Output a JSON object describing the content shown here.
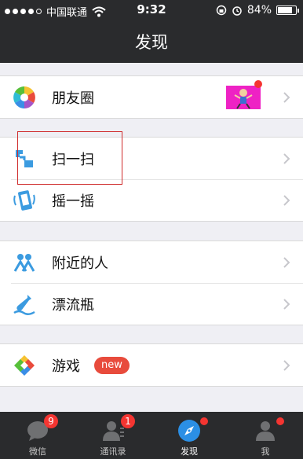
{
  "status_bar": {
    "carrier": "中国联通",
    "time": "9:32",
    "battery": "84%",
    "signal_bars": 4,
    "battery_level": 0.84
  },
  "header": {
    "title": "发现"
  },
  "groups": [
    {
      "items": [
        {
          "label": "朋友圈",
          "icon": "moments-icon",
          "has_thumbnail": true,
          "has_red_dot": true
        }
      ]
    },
    {
      "items": [
        {
          "label": "扫一扫",
          "icon": "scan-icon"
        },
        {
          "label": "摇一摇",
          "icon": "shake-icon"
        }
      ]
    },
    {
      "items": [
        {
          "label": "附近的人",
          "icon": "people-nearby-icon"
        },
        {
          "label": "漂流瓶",
          "icon": "drift-bottle-icon"
        }
      ]
    },
    {
      "items": [
        {
          "label": "游戏",
          "icon": "games-icon",
          "badge": "new"
        }
      ]
    }
  ],
  "tabbar": {
    "tabs": [
      {
        "label": "微信",
        "badge": "9",
        "icon": "chat-icon"
      },
      {
        "label": "通讯录",
        "badge": "1",
        "icon": "contacts-icon"
      },
      {
        "label": "发现",
        "active": true,
        "icon": "compass-icon",
        "red_dot": true
      },
      {
        "label": "我",
        "icon": "me-icon",
        "red_dot": true
      }
    ]
  },
  "colors": {
    "bar_bg": "#2a2b2d",
    "page_bg": "#efeff4",
    "accent_red": "#f43531",
    "highlight_border": "#cf2b2b",
    "active_tab": "#2b8fe5"
  }
}
